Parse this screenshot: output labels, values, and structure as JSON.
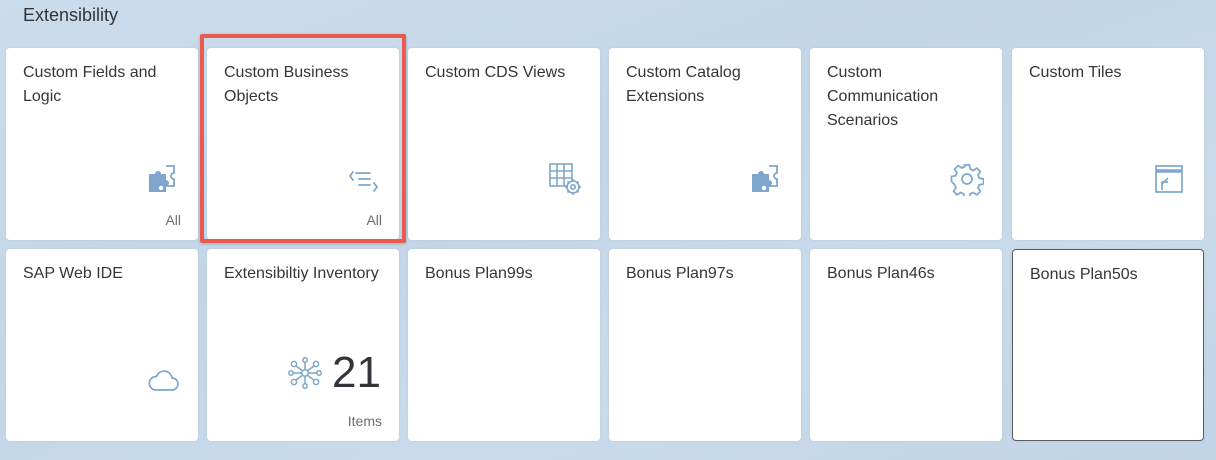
{
  "group": {
    "title": "Extensibility"
  },
  "tiles": [
    {
      "title": "Custom Fields and Logic",
      "info": "All",
      "icon": "puzzle-icon"
    },
    {
      "title": "Custom Business Objects",
      "info": "All",
      "icon": "code-list-icon"
    },
    {
      "title": "Custom CDS Views",
      "info": "",
      "icon": "table-settings-icon"
    },
    {
      "title": "Custom Catalog Extensions",
      "info": "",
      "icon": "puzzle-icon"
    },
    {
      "title": "Custom Communication Scenarios",
      "info": "",
      "icon": "gear-icon"
    },
    {
      "title": "Custom Tiles",
      "info": "",
      "icon": "tile-launch-icon"
    },
    {
      "title": "SAP Web IDE",
      "info": "",
      "icon": "cloud-icon"
    },
    {
      "title": "Extensibiltiy Inventory",
      "info": "Items",
      "kpi": "21",
      "icon": "network-icon"
    },
    {
      "title": "Bonus Plan99s",
      "info": ""
    },
    {
      "title": "Bonus Plan97s",
      "info": ""
    },
    {
      "title": "Bonus Plan46s",
      "info": ""
    },
    {
      "title": "Bonus Plan50s",
      "info": ""
    }
  ],
  "colors": {
    "icon": "#7fa6cc",
    "highlight": "#ea5a4e",
    "tile": "#ffffff"
  }
}
